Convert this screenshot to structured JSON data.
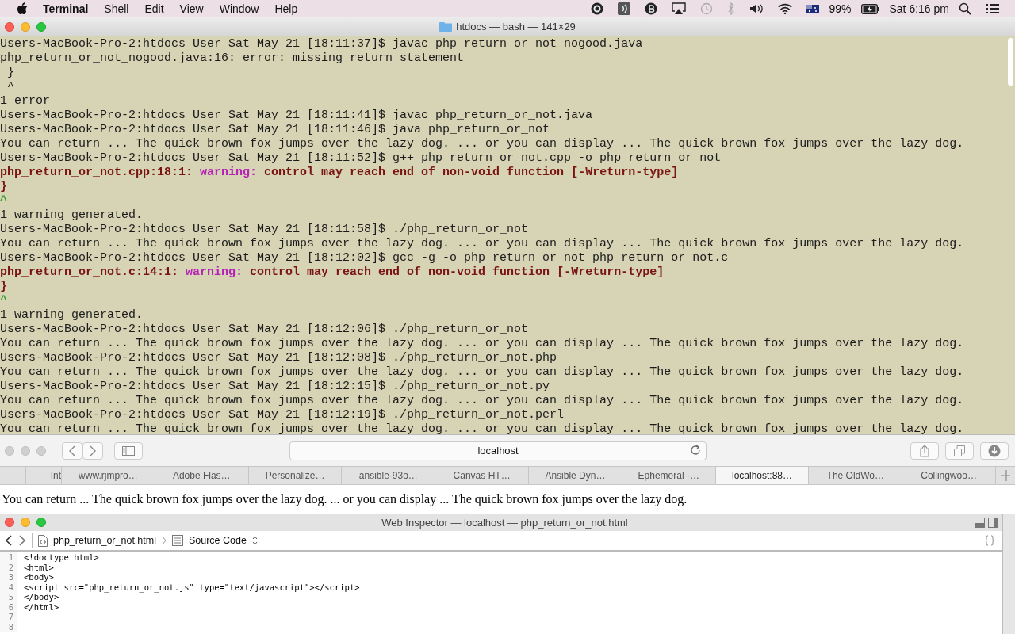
{
  "menu_bar": {
    "app": "Terminal",
    "menus": [
      "Shell",
      "Edit",
      "View",
      "Window",
      "Help"
    ],
    "battery": "99%",
    "clock": "Sat 6:16 pm"
  },
  "terminal": {
    "title": "htdocs — bash — 141×29",
    "lines": [
      {
        "kind": "plain",
        "text": "Users-MacBook-Pro-2:htdocs User Sat May 21 [18:11:37]$ javac php_return_or_not_nogood.java"
      },
      {
        "kind": "plain",
        "text": "php_return_or_not_nogood.java:16: error: missing return statement"
      },
      {
        "kind": "plain",
        "text": " }"
      },
      {
        "kind": "plain",
        "text": " ^"
      },
      {
        "kind": "plain",
        "text": "1 error"
      },
      {
        "kind": "plain",
        "text": "Users-MacBook-Pro-2:htdocs User Sat May 21 [18:11:41]$ javac php_return_or_not.java"
      },
      {
        "kind": "plain",
        "text": "Users-MacBook-Pro-2:htdocs User Sat May 21 [18:11:46]$ java php_return_or_not"
      },
      {
        "kind": "plain",
        "text": "You can return ... The quick brown fox jumps over the lazy dog. ... or you can display ... The quick brown fox jumps over the lazy dog."
      },
      {
        "kind": "plain",
        "text": "Users-MacBook-Pro-2:htdocs User Sat May 21 [18:11:52]$ g++ php_return_or_not.cpp -o php_return_or_not"
      },
      {
        "kind": "diagnostic",
        "location": "php_return_or_not.cpp:18:1:",
        "severity": "warning:",
        "message": "control may reach end of non-void function [-Wreturn-type]"
      },
      {
        "kind": "bold",
        "text": "}"
      },
      {
        "kind": "caret",
        "text": "^"
      },
      {
        "kind": "plain",
        "text": "1 warning generated."
      },
      {
        "kind": "plain",
        "text": "Users-MacBook-Pro-2:htdocs User Sat May 21 [18:11:58]$ ./php_return_or_not"
      },
      {
        "kind": "plain",
        "text": "You can return ... The quick brown fox jumps over the lazy dog. ... or you can display ... The quick brown fox jumps over the lazy dog."
      },
      {
        "kind": "plain",
        "text": "Users-MacBook-Pro-2:htdocs User Sat May 21 [18:12:02]$ gcc -g -o php_return_or_not php_return_or_not.c"
      },
      {
        "kind": "diagnostic",
        "location": "php_return_or_not.c:14:1:",
        "severity": "warning:",
        "message": "control may reach end of non-void function [-Wreturn-type]"
      },
      {
        "kind": "bold",
        "text": "}"
      },
      {
        "kind": "caret",
        "text": "^"
      },
      {
        "kind": "plain",
        "text": "1 warning generated."
      },
      {
        "kind": "plain",
        "text": "Users-MacBook-Pro-2:htdocs User Sat May 21 [18:12:06]$ ./php_return_or_not"
      },
      {
        "kind": "plain",
        "text": "You can return ... The quick brown fox jumps over the lazy dog. ... or you can display ... The quick brown fox jumps over the lazy dog."
      },
      {
        "kind": "plain",
        "text": "Users-MacBook-Pro-2:htdocs User Sat May 21 [18:12:08]$ ./php_return_or_not.php"
      },
      {
        "kind": "plain",
        "text": "You can return ... The quick brown fox jumps over the lazy dog. ... or you can display ... The quick brown fox jumps over the lazy dog."
      },
      {
        "kind": "plain",
        "text": "Users-MacBook-Pro-2:htdocs User Sat May 21 [18:12:15]$ ./php_return_or_not.py"
      },
      {
        "kind": "plain",
        "text": "You can return ... The quick brown fox jumps over the lazy dog. ... or you can display ... The quick brown fox jumps over the lazy dog."
      },
      {
        "kind": "plain",
        "text": "Users-MacBook-Pro-2:htdocs User Sat May 21 [18:12:19]$ ./php_return_or_not.perl"
      },
      {
        "kind": "plain",
        "text": "You can return ... The quick brown fox jumps over the lazy dog. ... or you can display ... The quick brown fox jumps over the lazy dog."
      }
    ]
  },
  "browser": {
    "address": "localhost",
    "tabs": [
      {
        "label": "Int",
        "selected": false
      },
      {
        "label": "www.rjmpro…",
        "selected": false
      },
      {
        "label": "Adobe Flas…",
        "selected": false
      },
      {
        "label": "Personalize…",
        "selected": false
      },
      {
        "label": "ansible-93o…",
        "selected": false
      },
      {
        "label": "Canvas HT…",
        "selected": false
      },
      {
        "label": "Ansible Dyn…",
        "selected": false
      },
      {
        "label": "Ephemeral -…",
        "selected": false
      },
      {
        "label": "localhost:88…",
        "selected": true
      },
      {
        "label": "The OldWo…",
        "selected": false
      },
      {
        "label": "Collingwoo…",
        "selected": false
      }
    ],
    "page_text": "You can return ... The quick brown fox jumps over the lazy dog. ... or you can display ... The quick brown fox jumps over the lazy dog."
  },
  "inspector": {
    "title": "Web Inspector — localhost — php_return_or_not.html",
    "file": "php_return_or_not.html",
    "view": "Source Code",
    "lines": [
      {
        "number": "1",
        "code": "<!doctype html>"
      },
      {
        "number": "2",
        "code": "<html>"
      },
      {
        "number": "3",
        "code": "<body>"
      },
      {
        "number": "4",
        "code": "<script src=\"php_return_or_not.js\" type=\"text/javascript\"></script>"
      },
      {
        "number": "5",
        "code": "</body>"
      },
      {
        "number": "6",
        "code": "</html>"
      },
      {
        "number": "7"
      },
      {
        "number": "8"
      }
    ]
  }
}
